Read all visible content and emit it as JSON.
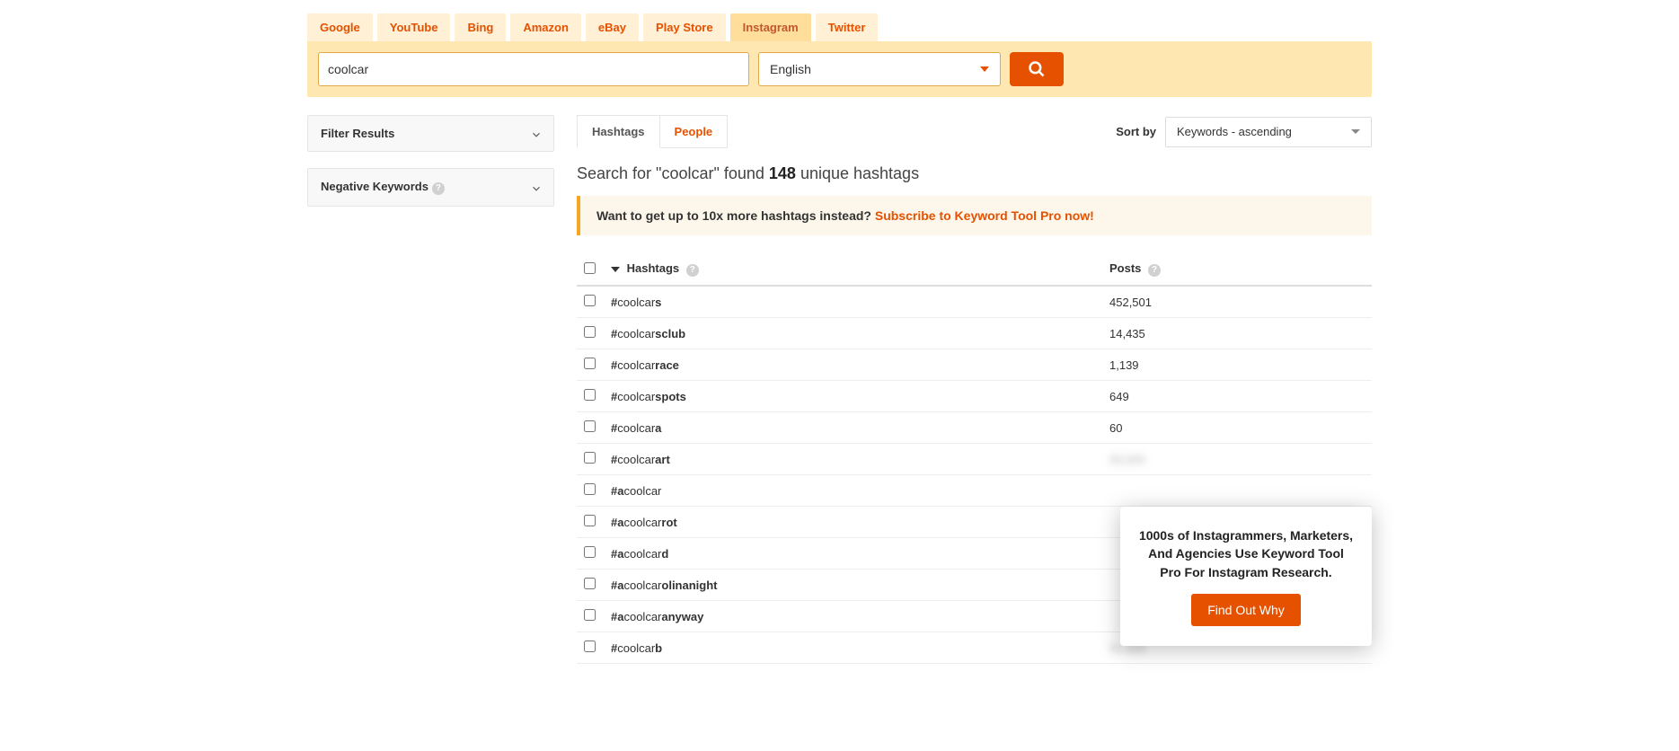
{
  "source_tabs": [
    "Google",
    "YouTube",
    "Bing",
    "Amazon",
    "eBay",
    "Play Store",
    "Instagram",
    "Twitter"
  ],
  "active_source_index": 6,
  "search": {
    "value": "coolcar",
    "language": "English"
  },
  "left_panels": {
    "filter_label": "Filter Results",
    "negative_label": "Negative Keywords"
  },
  "result_tabs": {
    "items": [
      "Hashtags",
      "People"
    ],
    "active": 0
  },
  "sort": {
    "label": "Sort by",
    "selected": "Keywords - ascending"
  },
  "summary": {
    "prefix": "Search for \"",
    "term": "coolcar",
    "mid": "\" found ",
    "count": "148",
    "suffix": " unique hashtags"
  },
  "promo": {
    "text": "Want to get up to 10x more hashtags instead? ",
    "link": "Subscribe to Keyword Tool Pro now!"
  },
  "columns": {
    "hashtags": "Hashtags",
    "posts": "Posts"
  },
  "rows": [
    {
      "prefix": "#coolcar",
      "bold": "s",
      "posts": "452,501",
      "blur": false
    },
    {
      "prefix": "#coolcar",
      "bold": "sclub",
      "posts": "14,435",
      "blur": false
    },
    {
      "prefix": "#coolcar",
      "bold": "race",
      "posts": "1,139",
      "blur": false
    },
    {
      "prefix": "#coolcar",
      "bold": "spots",
      "posts": "649",
      "blur": false
    },
    {
      "prefix": "#coolcar",
      "bold": "a",
      "posts": "60",
      "blur": false
    },
    {
      "prefix": "#coolcar",
      "bold": "art",
      "posts": "00,000",
      "blur": true
    },
    {
      "prefix": "#",
      "bold_pre": "a",
      "mid": "coolcar",
      "bold": "",
      "posts": "",
      "blur": false
    },
    {
      "prefix": "#",
      "bold_pre": "a",
      "mid": "coolcar",
      "bold": "rot",
      "posts": "",
      "blur": false
    },
    {
      "prefix": "#",
      "bold_pre": "a",
      "mid": "coolcar",
      "bold": "d",
      "posts": "",
      "blur": false
    },
    {
      "prefix": "#",
      "bold_pre": "a",
      "mid": "coolcar",
      "bold": "olinanight",
      "posts": "",
      "blur": false
    },
    {
      "prefix": "#",
      "bold_pre": "a",
      "mid": "coolcar",
      "bold": "anyway",
      "posts": "",
      "blur": false
    },
    {
      "prefix": "#coolcar",
      "bold": "b",
      "posts": "00,000",
      "blur": true
    }
  ],
  "popup": {
    "text": "1000s of Instagrammers, Marketers, And Agencies Use Keyword Tool Pro For Instagram Research.",
    "button": "Find Out Why"
  }
}
